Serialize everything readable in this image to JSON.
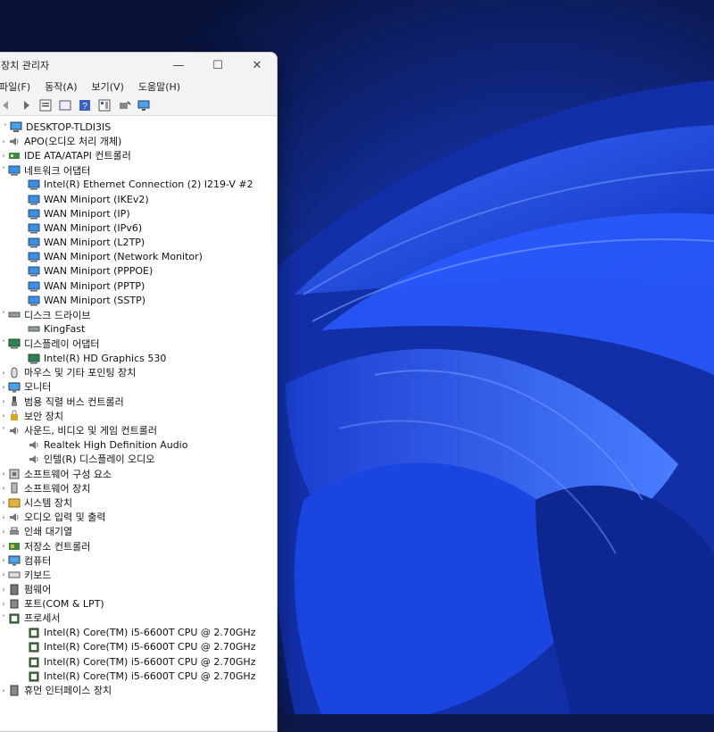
{
  "window": {
    "title": "장치 관리자",
    "controls": {
      "minimize": "—",
      "maximize": "☐",
      "close": "✕"
    }
  },
  "menu": [
    "파일(F)",
    "동작(A)",
    "보기(V)",
    "도움말(H)"
  ],
  "tree": {
    "root": "DESKTOP-TLDI3IS",
    "nodes": [
      {
        "label": "APO(오디오 처리 개체)",
        "icon": "speaker-icon",
        "expanded": false
      },
      {
        "label": "IDE ATA/ATAPI 컨트롤러",
        "icon": "controller-icon",
        "expanded": false
      },
      {
        "label": "네트워크 어댑터",
        "icon": "network-icon",
        "expanded": true,
        "children": [
          {
            "label": "Intel(R) Ethernet Connection (2) I219-V #2",
            "icon": "network-icon"
          },
          {
            "label": "WAN Miniport (IKEv2)",
            "icon": "network-icon"
          },
          {
            "label": "WAN Miniport (IP)",
            "icon": "network-icon"
          },
          {
            "label": "WAN Miniport (IPv6)",
            "icon": "network-icon"
          },
          {
            "label": "WAN Miniport (L2TP)",
            "icon": "network-icon"
          },
          {
            "label": "WAN Miniport (Network Monitor)",
            "icon": "network-icon"
          },
          {
            "label": "WAN Miniport (PPPOE)",
            "icon": "network-icon"
          },
          {
            "label": "WAN Miniport (PPTP)",
            "icon": "network-icon"
          },
          {
            "label": "WAN Miniport (SSTP)",
            "icon": "network-icon"
          }
        ]
      },
      {
        "label": "디스크 드라이브",
        "icon": "disk-icon",
        "expanded": true,
        "children": [
          {
            "label": "KingFast",
            "icon": "disk-icon"
          }
        ]
      },
      {
        "label": "디스플레이 어댑터",
        "icon": "display-adapter-icon",
        "expanded": true,
        "children": [
          {
            "label": "Intel(R) HD Graphics 530",
            "icon": "display-adapter-icon"
          }
        ]
      },
      {
        "label": "마우스 및 기타 포인팅 장치",
        "icon": "mouse-icon",
        "expanded": false
      },
      {
        "label": "모니터",
        "icon": "monitor-icon",
        "expanded": false
      },
      {
        "label": "범용 직렬 버스 컨트롤러",
        "icon": "usb-icon",
        "expanded": false
      },
      {
        "label": "보안 장치",
        "icon": "security-icon",
        "expanded": false
      },
      {
        "label": "사운드, 비디오 및 게임 컨트롤러",
        "icon": "speaker-icon",
        "expanded": true,
        "children": [
          {
            "label": "Realtek High Definition Audio",
            "icon": "speaker-icon"
          },
          {
            "label": "인텔(R) 디스플레이 오디오",
            "icon": "speaker-icon"
          }
        ]
      },
      {
        "label": "소프트웨어 구성 요소",
        "icon": "component-icon",
        "expanded": false
      },
      {
        "label": "소프트웨어 장치",
        "icon": "software-device-icon",
        "expanded": false
      },
      {
        "label": "시스템 장치",
        "icon": "system-folder-icon",
        "expanded": false
      },
      {
        "label": "오디오 입력 및 출력",
        "icon": "speaker-icon",
        "expanded": false
      },
      {
        "label": "인쇄 대기열",
        "icon": "printer-icon",
        "expanded": false
      },
      {
        "label": "저장소 컨트롤러",
        "icon": "storage-icon",
        "expanded": false
      },
      {
        "label": "컴퓨터",
        "icon": "monitor-icon",
        "expanded": false
      },
      {
        "label": "키보드",
        "icon": "keyboard-icon",
        "expanded": false
      },
      {
        "label": "펌웨어",
        "icon": "firmware-icon",
        "expanded": false
      },
      {
        "label": "포트(COM & LPT)",
        "icon": "port-icon",
        "expanded": false
      },
      {
        "label": "프로세서",
        "icon": "processor-icon",
        "expanded": true,
        "children": [
          {
            "label": "Intel(R) Core(TM) i5-6600T CPU @ 2.70GHz",
            "icon": "processor-icon"
          },
          {
            "label": "Intel(R) Core(TM) i5-6600T CPU @ 2.70GHz",
            "icon": "processor-icon"
          },
          {
            "label": "Intel(R) Core(TM) i5-6600T CPU @ 2.70GHz",
            "icon": "processor-icon"
          },
          {
            "label": "Intel(R) Core(TM) i5-6600T CPU @ 2.70GHz",
            "icon": "processor-icon"
          }
        ]
      },
      {
        "label": "휴먼 인터페이스 장치",
        "icon": "hid-icon",
        "expanded": false
      }
    ]
  }
}
